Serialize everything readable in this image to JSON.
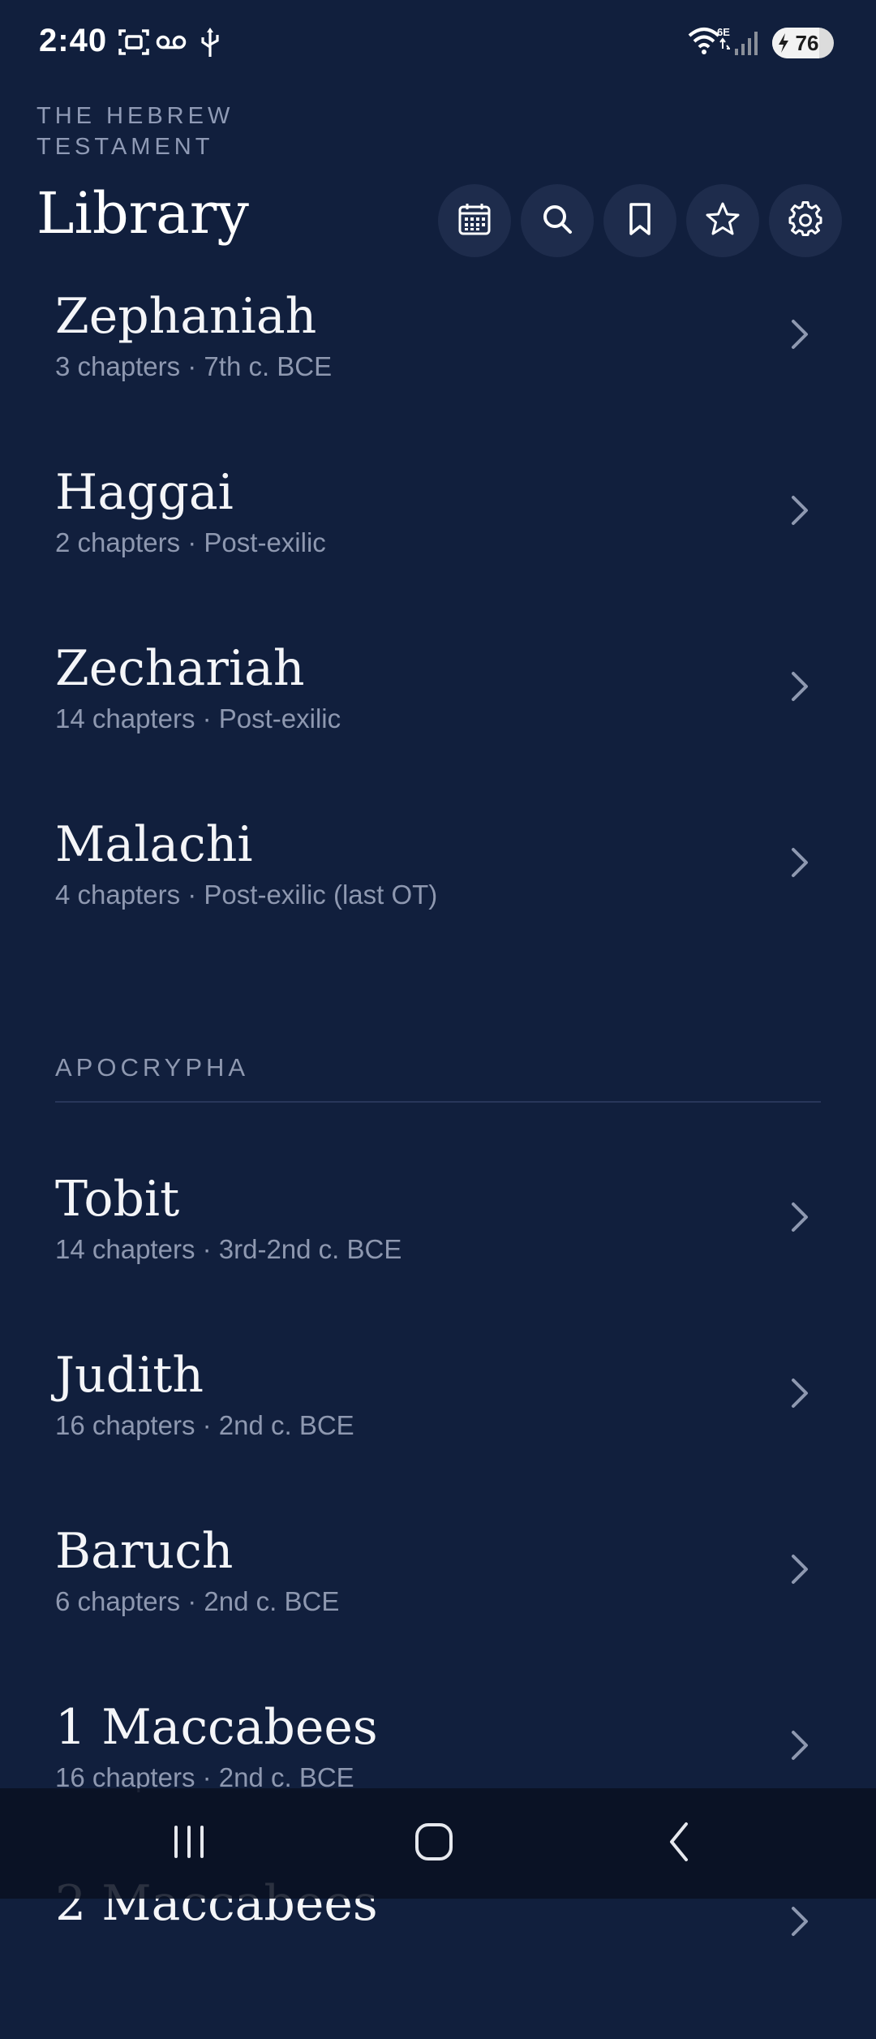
{
  "status_bar": {
    "time": "2:40",
    "battery": "76",
    "battery_fraction": 0.76,
    "network": "6E",
    "icons": [
      "screenshot-icon",
      "voicemail-icon",
      "usb-icon",
      "wifi-icon",
      "signal-icon",
      "battery-icon"
    ]
  },
  "header": {
    "eyebrow": "THE HEBREW TESTAMENT",
    "title": "Library",
    "actions": [
      "calendar-icon",
      "search-icon",
      "bookmark-icon",
      "star-icon",
      "gear-icon"
    ]
  },
  "books_top": [
    {
      "name": "Zephaniah",
      "meta": "3 chapters · 7th c. BCE"
    },
    {
      "name": "Haggai",
      "meta": "2 chapters · Post-exilic"
    },
    {
      "name": "Zechariah",
      "meta": "14 chapters · Post-exilic"
    },
    {
      "name": "Malachi",
      "meta": "4 chapters · Post-exilic (last OT)"
    }
  ],
  "section": {
    "label": "APOCRYPHA"
  },
  "books_apocrypha": [
    {
      "name": "Tobit",
      "meta": "14 chapters · 3rd-2nd c. BCE"
    },
    {
      "name": "Judith",
      "meta": "16 chapters · 2nd c. BCE"
    },
    {
      "name": "Baruch",
      "meta": "6 chapters · 2nd c. BCE"
    },
    {
      "name": "1 Maccabees",
      "meta": "16 chapters · 2nd c. BCE"
    },
    {
      "name": "2 Maccabees",
      "meta": ""
    }
  ],
  "colors": {
    "background": "#111f3d",
    "icon_button": "#1e2c4c",
    "muted_text": "#8e98b0",
    "nav_bar": "#0a1122"
  }
}
